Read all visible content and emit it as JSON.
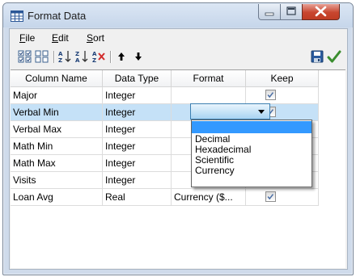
{
  "window": {
    "title": "Format Data",
    "icon": "table-grid-icon",
    "controls": [
      "minimize-icon",
      "maximize-icon",
      "close-icon"
    ],
    "close_color": "#c8462f"
  },
  "menu": {
    "items": [
      {
        "label": "File",
        "accel": "F"
      },
      {
        "label": "Edit",
        "accel": "E"
      },
      {
        "label": "Sort",
        "accel": "S"
      }
    ]
  },
  "toolbar": {
    "left": [
      "select-all-icon",
      "select-none-icon",
      "sort-ascending-icon",
      "sort-descending-icon",
      "clear-sort-icon",
      "move-up-icon",
      "move-down-icon"
    ],
    "right": [
      "save-icon",
      "apply-check-icon"
    ],
    "accent": "#3a8d2e"
  },
  "grid": {
    "headers": [
      "Column Name",
      "Data Type",
      "Format",
      "Keep"
    ],
    "selected_color": "#c5e1f7",
    "rows": [
      {
        "name": "Major",
        "type": "Integer",
        "format": "",
        "keep": true
      },
      {
        "name": "Verbal Min",
        "type": "Integer",
        "format": "",
        "keep": true
      },
      {
        "name": "Verbal Max",
        "type": "Integer",
        "format": "",
        "keep": true
      },
      {
        "name": "Math Min",
        "type": "Integer",
        "format": "",
        "keep": true
      },
      {
        "name": "Math Max",
        "type": "Integer",
        "format": "",
        "keep": true
      },
      {
        "name": "Visits",
        "type": "Integer",
        "format": "",
        "keep": true
      },
      {
        "name": "Loan Avg",
        "type": "Real",
        "format": "Currency ($...",
        "keep": true
      }
    ],
    "selected_row": 1
  },
  "format_dropdown": {
    "selected": "",
    "options": [
      "",
      "Decimal",
      "Hexadecimal",
      "Scientific",
      "Currency"
    ],
    "highlight_color": "#3399ff"
  }
}
